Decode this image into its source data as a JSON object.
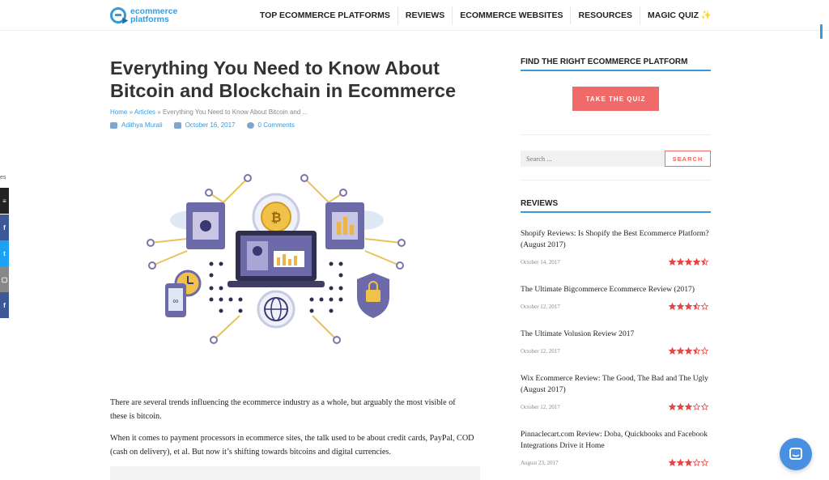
{
  "header": {
    "logo_line1": "ecommerce",
    "logo_line2": "platforms",
    "nav": [
      "TOP ECOMMERCE PLATFORMS",
      "REVIEWS",
      "ECOMMERCE WEBSITES",
      "RESOURCES",
      "MAGIC QUIZ ✨"
    ]
  },
  "share": {
    "label": "es",
    "buttons": [
      {
        "icon": "menu-icon",
        "color": "#222222"
      },
      {
        "icon": "facebook-icon",
        "color": "#3b5998"
      },
      {
        "icon": "twitter-icon",
        "color": "#1da1f2"
      },
      {
        "icon": "email-icon",
        "color": "#888888"
      },
      {
        "icon": "facebook-icon",
        "color": "#3b5998"
      }
    ]
  },
  "article": {
    "title_line1": "Everything You Need to Know About",
    "title_line2": "Bitcoin and Blockchain in Ecommerce",
    "breadcrumb": {
      "home": "Home",
      "sep": "»",
      "articles": "Articles",
      "current": "Everything You Need to Know About Bitcoin and ..."
    },
    "author": "Adithya Murali",
    "date": "October 16, 2017",
    "comments": "0 Comments",
    "paragraphs": [
      "There are several trends influencing the ecommerce industry as a whole, but arguably the most visible of these is bitcoin.",
      "When it comes to payment processors in ecommerce sites, the talk used to be about credit cards, PayPal, COD (cash on delivery), et al. But now it’s shifting towards bitcoins and digital currencies."
    ]
  },
  "sidebar": {
    "quiz_heading": "FIND THE RIGHT ECOMMERCE PLATFORM",
    "quiz_button": "TAKE THE QUIZ",
    "search_placeholder": "Search ...",
    "search_button": "SEARCH",
    "reviews_heading": "REVIEWS",
    "reviews": [
      {
        "title": "Shopify Reviews: Is Shopify the Best Ecommerce Platform? (August 2017)",
        "date": "October 14, 2017",
        "rating": 4.5
      },
      {
        "title": "The Ultimate Bigcommerce Ecommerce Review (2017)",
        "date": "October 12, 2017",
        "rating": 3.5
      },
      {
        "title": "The Ultimate Volusion Review 2017",
        "date": "October 12, 2017",
        "rating": 3.5
      },
      {
        "title": "Wix Ecommerce Review: The Good, The Bad and The Ugly (August 2017)",
        "date": "October 12, 2017",
        "rating": 3
      },
      {
        "title": "Pinnaclecart.com Review: Doba, Quickbooks and Facebook Integrations Drive it Home",
        "date": "August 23, 2017",
        "rating": 3
      }
    ]
  },
  "colors": {
    "accent": "#3a9ad9",
    "cta": "#f06a6a",
    "star": "#e04848",
    "chat": "#4a90e2"
  }
}
